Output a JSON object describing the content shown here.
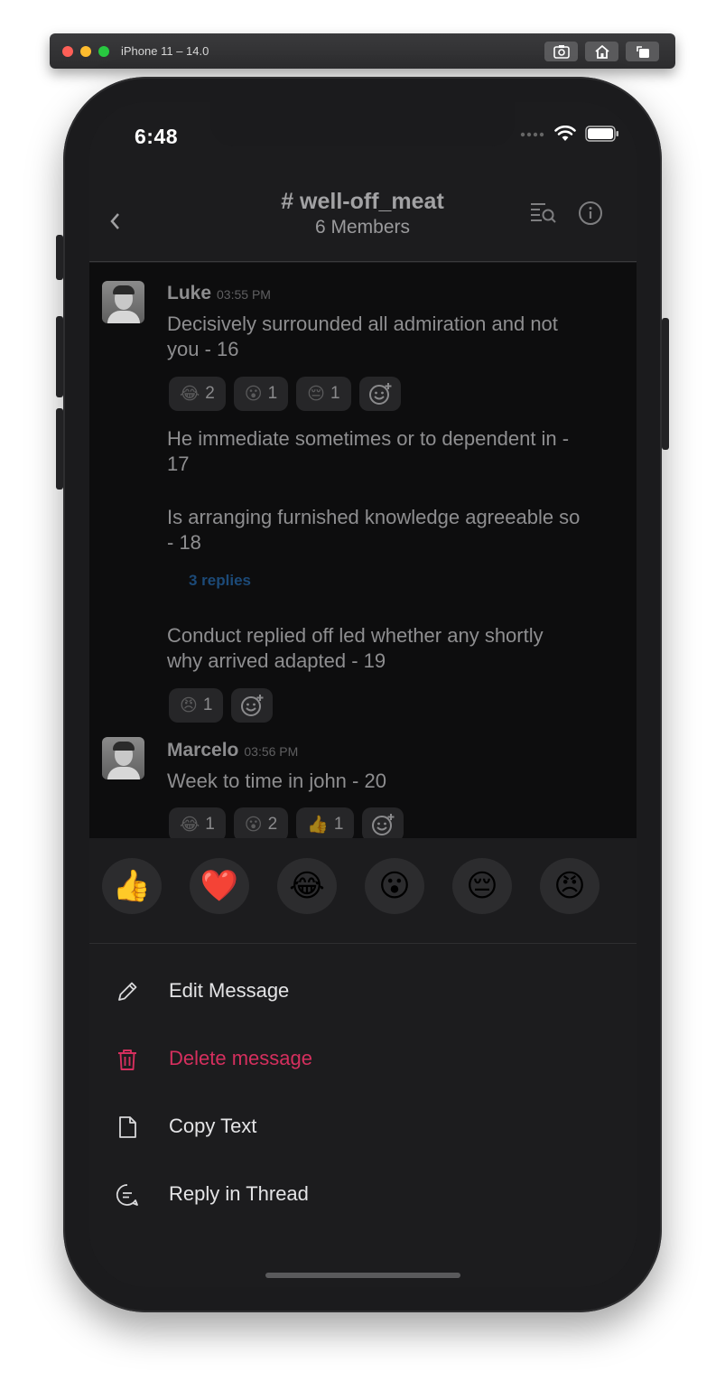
{
  "simulator": {
    "title": "iPhone 11 – 14.0",
    "buttons": [
      "screenshot-icon",
      "home-icon",
      "rotate-icon"
    ]
  },
  "status_bar": {
    "time": "6:48"
  },
  "header": {
    "title": "# well-off_meat",
    "subtitle": "6 Members",
    "back_icon": "chevron-left-icon",
    "icons": [
      "search-list-icon",
      "info-icon"
    ]
  },
  "messages": [
    {
      "user": "Luke",
      "time": "03:55 PM",
      "text": "Decisively surrounded all admiration and not you - 16",
      "reactions": [
        {
          "emoji": "😂",
          "count": "2"
        },
        {
          "emoji": "😮",
          "count": "1"
        },
        {
          "emoji": "😔",
          "count": "1"
        }
      ]
    },
    {
      "text": "He immediate sometimes or to dependent in - 17"
    },
    {
      "text": "Is arranging furnished knowledge agreeable so - 18",
      "replies": "3 replies"
    },
    {
      "text": "Conduct replied off led whether any shortly why arrived adapted - 19",
      "reactions": [
        {
          "emoji": "😠",
          "count": "1"
        }
      ]
    },
    {
      "user": "Marcelo",
      "time": "03:56 PM",
      "text": "Week to time in john - 20",
      "reactions": [
        {
          "emoji": "😂",
          "count": "1"
        },
        {
          "emoji": "😮",
          "count": "2"
        },
        {
          "emoji": "👍",
          "count": "1"
        }
      ]
    }
  ],
  "quick_reactions": [
    "👍",
    "❤️",
    "😂",
    "😮",
    "😔",
    "😠"
  ],
  "actions": [
    {
      "label": "Edit Message",
      "icon": "pencil-icon"
    },
    {
      "label": "Delete message",
      "icon": "trash-icon",
      "color": "#d52f5e"
    },
    {
      "label": "Copy Text",
      "icon": "document-icon"
    },
    {
      "label": "Reply in Thread",
      "icon": "thread-reply-icon"
    }
  ]
}
